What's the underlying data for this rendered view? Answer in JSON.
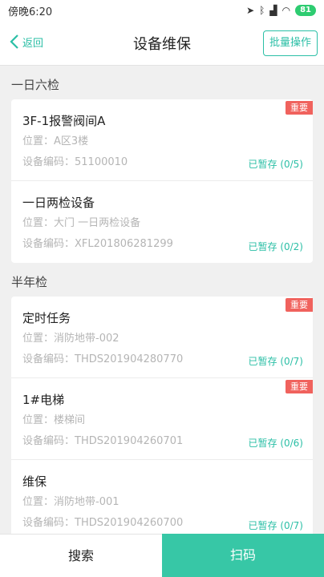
{
  "status_bar": {
    "time": "傍晚6:20",
    "battery": "81"
  },
  "header": {
    "back_label": "返回",
    "title": "设备维保",
    "batch_label": "批量操作"
  },
  "labels": {
    "location_prefix": "位置：",
    "code_prefix": "设备编码："
  },
  "groups": [
    {
      "title": "一日六检",
      "items": [
        {
          "name": "3F-1报警阀间A",
          "location": "A区3楼",
          "code": "51100010",
          "status": "已暂存 (0/5)",
          "tag": "重要"
        },
        {
          "name": "一日两检设备",
          "location": "大门 一日两检设备",
          "code": "XFL201806281299",
          "status": "已暂存 (0/2)",
          "tag": ""
        }
      ]
    },
    {
      "title": "半年检",
      "items": [
        {
          "name": "定时任务",
          "location": "消防地带-002",
          "code": "THDS201904280770",
          "status": "已暂存 (0/7)",
          "tag": "重要"
        },
        {
          "name": "1#电梯",
          "location": "楼梯间",
          "code": "THDS201904260701",
          "status": "已暂存 (0/6)",
          "tag": "重要"
        },
        {
          "name": "维保",
          "location": "消防地带-001",
          "code": "THDS201904260700",
          "status": "已暂存 (0/7)",
          "tag": ""
        }
      ]
    }
  ],
  "bottom": {
    "search_label": "搜索",
    "scan_label": "扫码"
  },
  "colors": {
    "accent": "#2bbfa6",
    "tag": "#f0625d",
    "scan_button": "#37c7a6"
  }
}
